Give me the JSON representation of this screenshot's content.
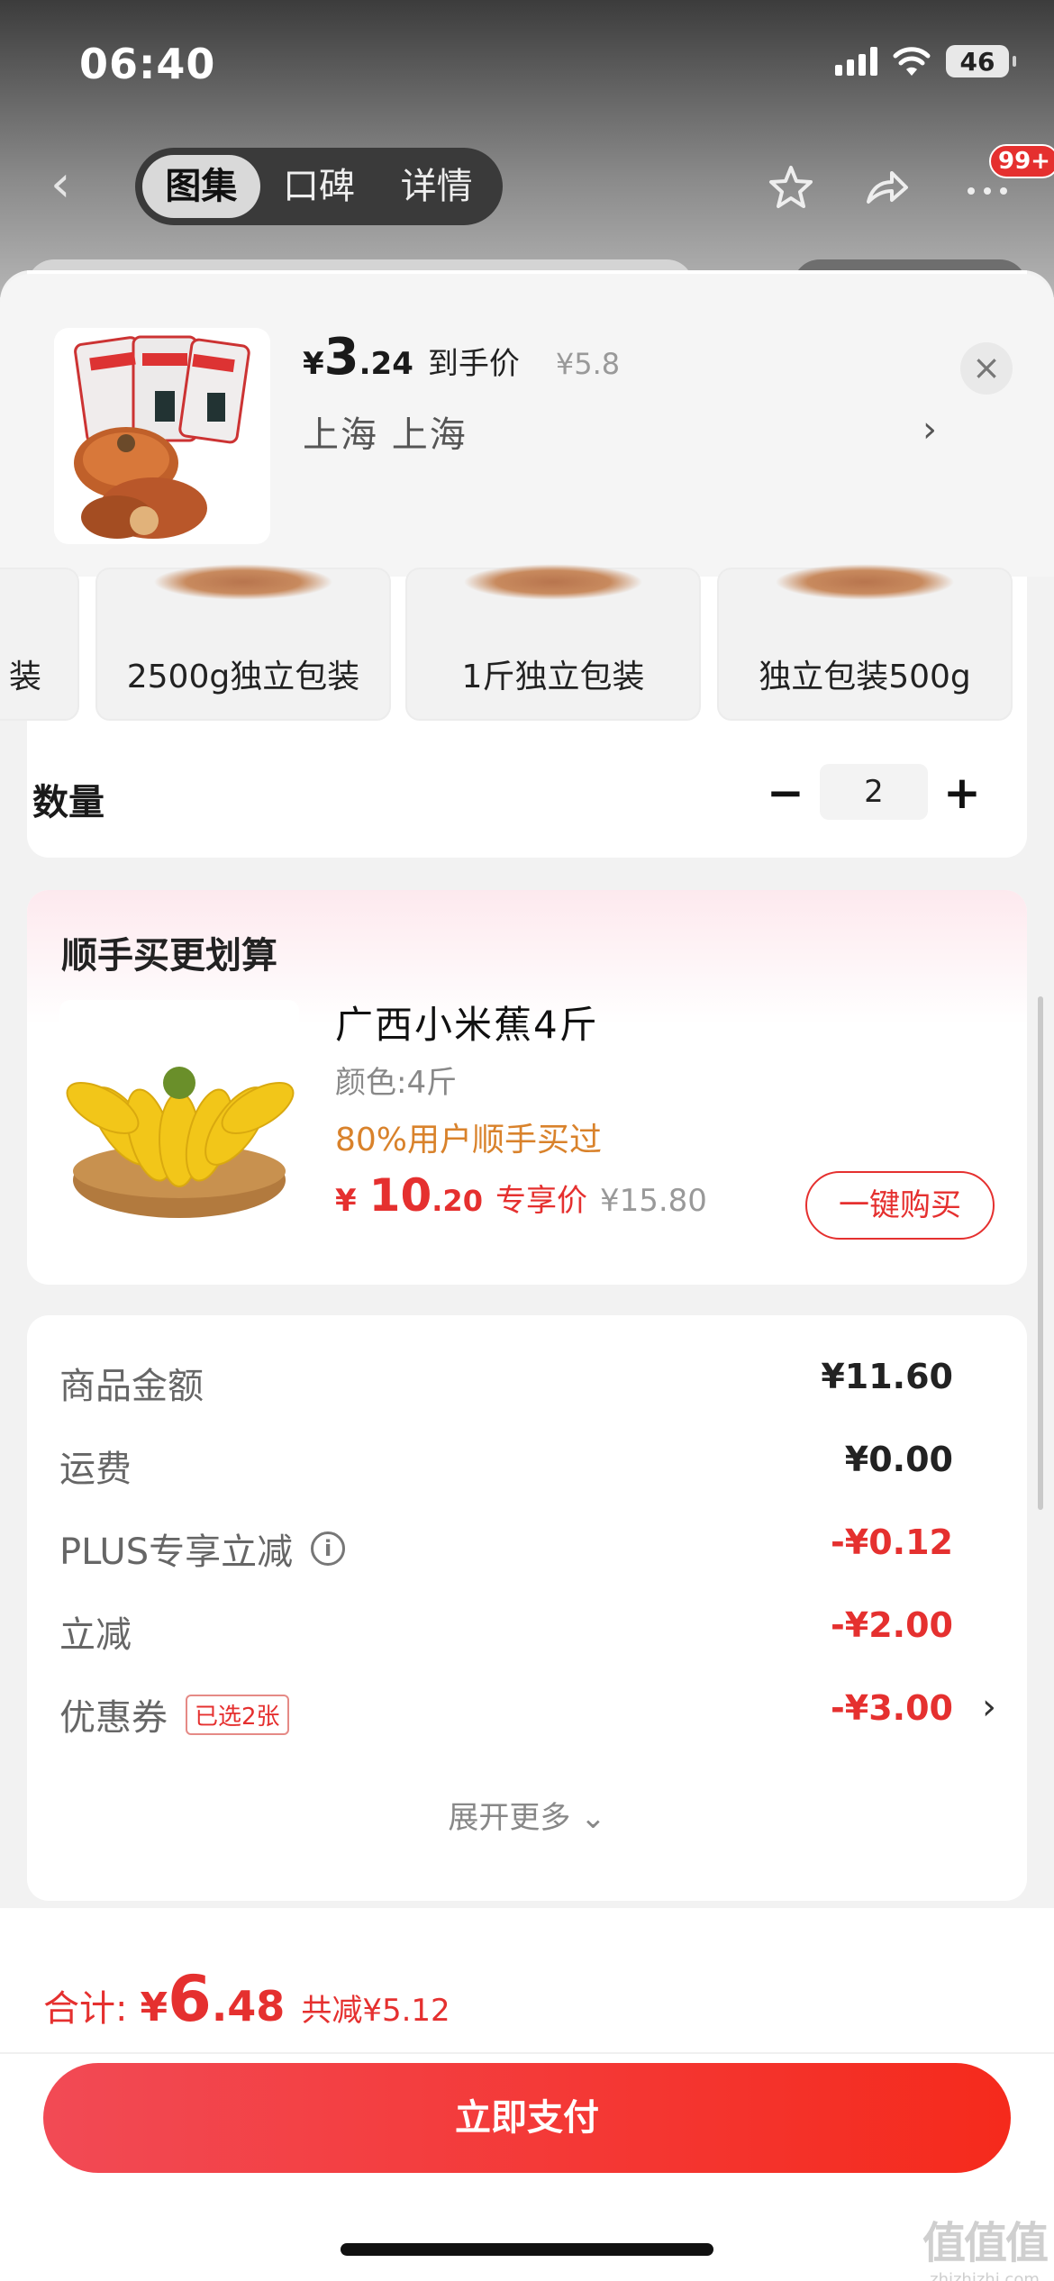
{
  "status_bar": {
    "time": "06:40",
    "battery": "46"
  },
  "nav": {
    "tabs": [
      "图集",
      "口碑",
      "详情"
    ],
    "active_tab": 0,
    "badge": "99+"
  },
  "header": {
    "price_currency": "¥",
    "price_int": "3",
    "price_dec": ".24",
    "price_tag": "到手价",
    "original_price": "¥5.8",
    "address": "上海  上海",
    "arrow": "›",
    "close": "×"
  },
  "sku": {
    "options": [
      "装",
      "2500g独立包装",
      "1斤独立包装",
      "独立包装500g"
    ]
  },
  "quantity": {
    "label": "数量",
    "minus": "−",
    "value": "2",
    "plus": "+"
  },
  "upsell": {
    "title": "顺手买更划算",
    "product_name": "广西小米蕉4斤",
    "spec": "颜色:4斤",
    "social_proof": "80%用户顺手买过",
    "price_currency": "¥",
    "price_int": "10",
    "price_dec": ".20",
    "price_tag": "专享价",
    "original_price": "¥15.80",
    "buy_button": "一键购买"
  },
  "summary": {
    "rows": [
      {
        "label": "商品金额",
        "value": "¥11.60",
        "red": false
      },
      {
        "label": "运费",
        "value": "¥0.00",
        "red": false
      },
      {
        "label": "PLUS专享立减",
        "value": "-¥0.12",
        "red": true
      },
      {
        "label": "立减",
        "value": "-¥2.00",
        "red": true
      },
      {
        "label": "优惠券",
        "value": "-¥3.00",
        "red": true
      }
    ],
    "coupon_tag": "已选2张",
    "expand_more": "展开更多 ⌄"
  },
  "footer": {
    "total_label": "合计:",
    "total_currency": "¥",
    "total_int": "6",
    "total_dec": ".48",
    "saved": "共减¥5.12",
    "pay_button": "立即支付"
  },
  "watermark": {
    "logo": "值值值",
    "site": "zhizhizhi.com"
  },
  "colors": {
    "accent_red": "#e5302f",
    "social_orange": "#d9822b"
  }
}
